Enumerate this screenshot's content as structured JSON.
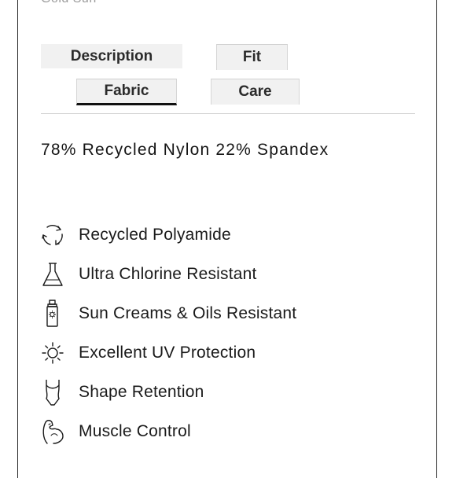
{
  "header": {
    "clipped_text": "Gold Sun"
  },
  "tabs": [
    {
      "label": "Description"
    },
    {
      "label": "Fit"
    },
    {
      "label": "Fabric",
      "active": true
    },
    {
      "label": "Care"
    }
  ],
  "fabric": {
    "composition": "78% Recycled Nylon 22% Spandex",
    "features": [
      {
        "icon": "recycle-icon",
        "label": "Recycled Polyamide"
      },
      {
        "icon": "flask-icon",
        "label": "Ultra Chlorine Resistant"
      },
      {
        "icon": "sunscreen-bottle-icon",
        "label": "Sun Creams & Oils Resistant"
      },
      {
        "icon": "sun-icon",
        "label": "Excellent UV Protection"
      },
      {
        "icon": "swimsuit-icon",
        "label": "Shape Retention"
      },
      {
        "icon": "muscle-arm-icon",
        "label": "Muscle Control"
      }
    ]
  },
  "colors": {
    "active_tab_underline": "#111111",
    "tab_background": "#f1f1f1",
    "divider": "#d3d3d3"
  }
}
